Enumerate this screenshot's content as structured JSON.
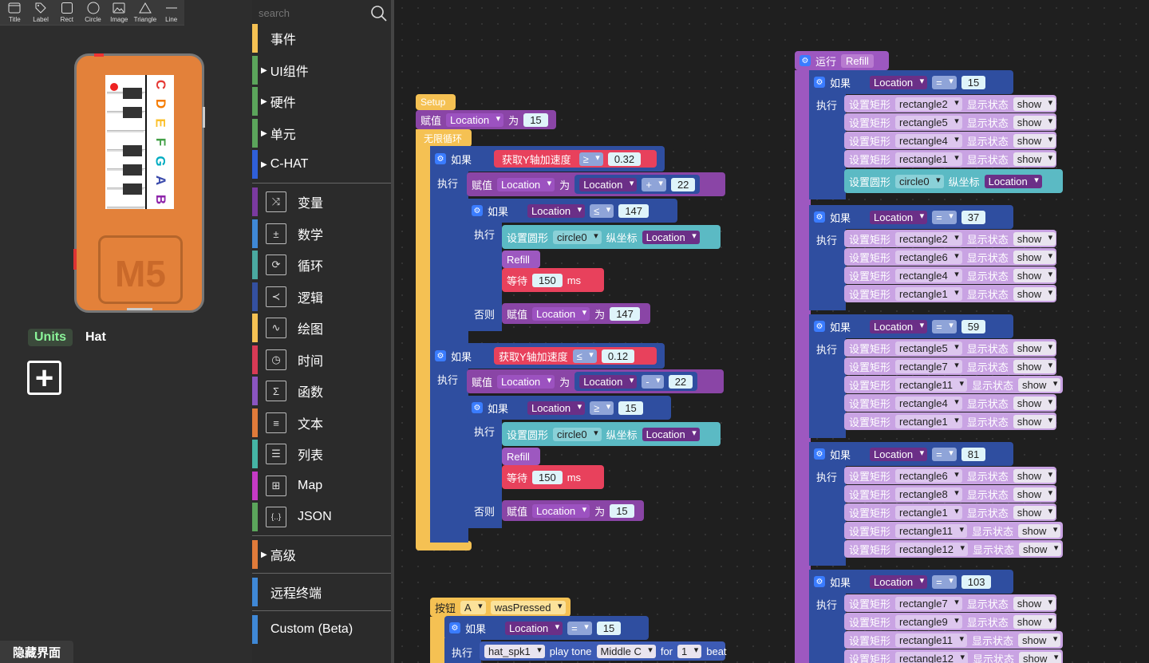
{
  "toolbar": {
    "tools": [
      {
        "label": "Title",
        "icon": "title-icon"
      },
      {
        "label": "Label",
        "icon": "label-icon"
      },
      {
        "label": "Rect",
        "icon": "rect-icon"
      },
      {
        "label": "Circle",
        "icon": "circle-icon"
      },
      {
        "label": "Image",
        "icon": "image-icon"
      },
      {
        "label": "Triangle",
        "icon": "triangle-icon"
      },
      {
        "label": "Line",
        "icon": "line-icon"
      }
    ]
  },
  "device": {
    "logo": "M5",
    "notes": [
      {
        "letter": "C",
        "color": "#e53935"
      },
      {
        "letter": "D",
        "color": "#f57c00"
      },
      {
        "letter": "E",
        "color": "#fbc02d"
      },
      {
        "letter": "F",
        "color": "#43a047"
      },
      {
        "letter": "G",
        "color": "#00acc1"
      },
      {
        "letter": "A",
        "color": "#3949ab"
      },
      {
        "letter": "B",
        "color": "#8e24aa"
      }
    ]
  },
  "tabs": {
    "units": "Units",
    "hat": "Hat"
  },
  "add_label": "+",
  "hide_ui": "隐藏界面",
  "search": {
    "placeholder": "search"
  },
  "categories": {
    "top": [
      {
        "name": "事件",
        "color": "#f5c153",
        "arrow": false
      },
      {
        "name": "UI组件",
        "color": "#5ba55b",
        "arrow": true
      },
      {
        "name": "硬件",
        "color": "#5ba55b",
        "arrow": true
      },
      {
        "name": "单元",
        "color": "#5ba55b",
        "arrow": true
      },
      {
        "name": "C-HAT",
        "color": "#2f5fd8",
        "arrow": true
      }
    ],
    "icons": [
      {
        "name": "变量",
        "color": "#7b3aa0",
        "icon": "shuffle-icon",
        "glyph": "⤨"
      },
      {
        "name": "数学",
        "color": "#3f88d6",
        "icon": "math-icon",
        "glyph": "±"
      },
      {
        "name": "循环",
        "color": "#4aa9a0",
        "icon": "loop-icon",
        "glyph": "⟳"
      },
      {
        "name": "逻辑",
        "color": "#3450a0",
        "icon": "logic-icon",
        "glyph": "≺"
      },
      {
        "name": "绘图",
        "color": "#f5c153",
        "icon": "graph-icon",
        "glyph": "∿"
      },
      {
        "name": "时间",
        "color": "#d83a55",
        "icon": "timer-icon",
        "glyph": "◷"
      },
      {
        "name": "函数",
        "color": "#8a55c0",
        "icon": "function-icon",
        "glyph": "Σ"
      },
      {
        "name": "文本",
        "color": "#e07b3a",
        "icon": "text-icon",
        "glyph": "≡"
      },
      {
        "name": "列表",
        "color": "#45b5a5",
        "icon": "list-icon",
        "glyph": "☰"
      },
      {
        "name": "Map",
        "color": "#c53ac5",
        "icon": "map-icon",
        "glyph": "⊞"
      },
      {
        "name": "JSON",
        "color": "#5ba55b",
        "icon": "json-icon",
        "glyph": "{..}"
      }
    ],
    "advanced": {
      "name": "高级",
      "color": "#e07b3a"
    },
    "remote": {
      "name": "远程终端",
      "color": "#3f88d6"
    },
    "custom": {
      "name": "Custom (Beta)",
      "color": "#3f88d6"
    }
  },
  "blocks": {
    "setup": "Setup",
    "assign": "赋值",
    "var_location": "Location",
    "as": "为",
    "v15": "15",
    "forever": "无限循环",
    "if": "如果",
    "do": "执行",
    "else": "否则",
    "get_y_acc": "获取Y轴加速度",
    "ge": "≥",
    "le": "≤",
    "plus": "+",
    "minus": "-",
    "v032": "0.32",
    "v012": "0.12",
    "v22": "22",
    "v147": "147",
    "set_circle": "设置圆形",
    "circle0": "circle0",
    "y_coord": "纵坐标",
    "refill": "Refill",
    "wait": "等待",
    "v150": "150",
    "ms": "ms",
    "button": "按钮",
    "btn_a": "A",
    "was_pressed": "wasPressed",
    "eq": "=",
    "hat_spk": "hat_spk1",
    "play_tone": "play tone",
    "middle_c": "Middle C",
    "for": "for",
    "v1": "1",
    "beat": "beat",
    "run": "运行",
    "set_rect": "设置矩形",
    "show_state": "显示状态",
    "show": "show"
  },
  "refill_groups": [
    {
      "value": "15",
      "rects": [
        "rectangle2",
        "rectangle5",
        "rectangle4",
        "rectangle1"
      ],
      "circle": true
    },
    {
      "value": "37",
      "rects": [
        "rectangle2",
        "rectangle6",
        "rectangle4",
        "rectangle1"
      ],
      "circle": false
    },
    {
      "value": "59",
      "rects": [
        "rectangle5",
        "rectangle7",
        "rectangle11",
        "rectangle4",
        "rectangle1"
      ],
      "circle": false
    },
    {
      "value": "81",
      "rects": [
        "rectangle6",
        "rectangle8",
        "rectangle1",
        "rectangle11",
        "rectangle12"
      ],
      "circle": false
    },
    {
      "value": "103",
      "rects": [
        "rectangle7",
        "rectangle9",
        "rectangle11",
        "rectangle12"
      ],
      "circle": false
    }
  ]
}
